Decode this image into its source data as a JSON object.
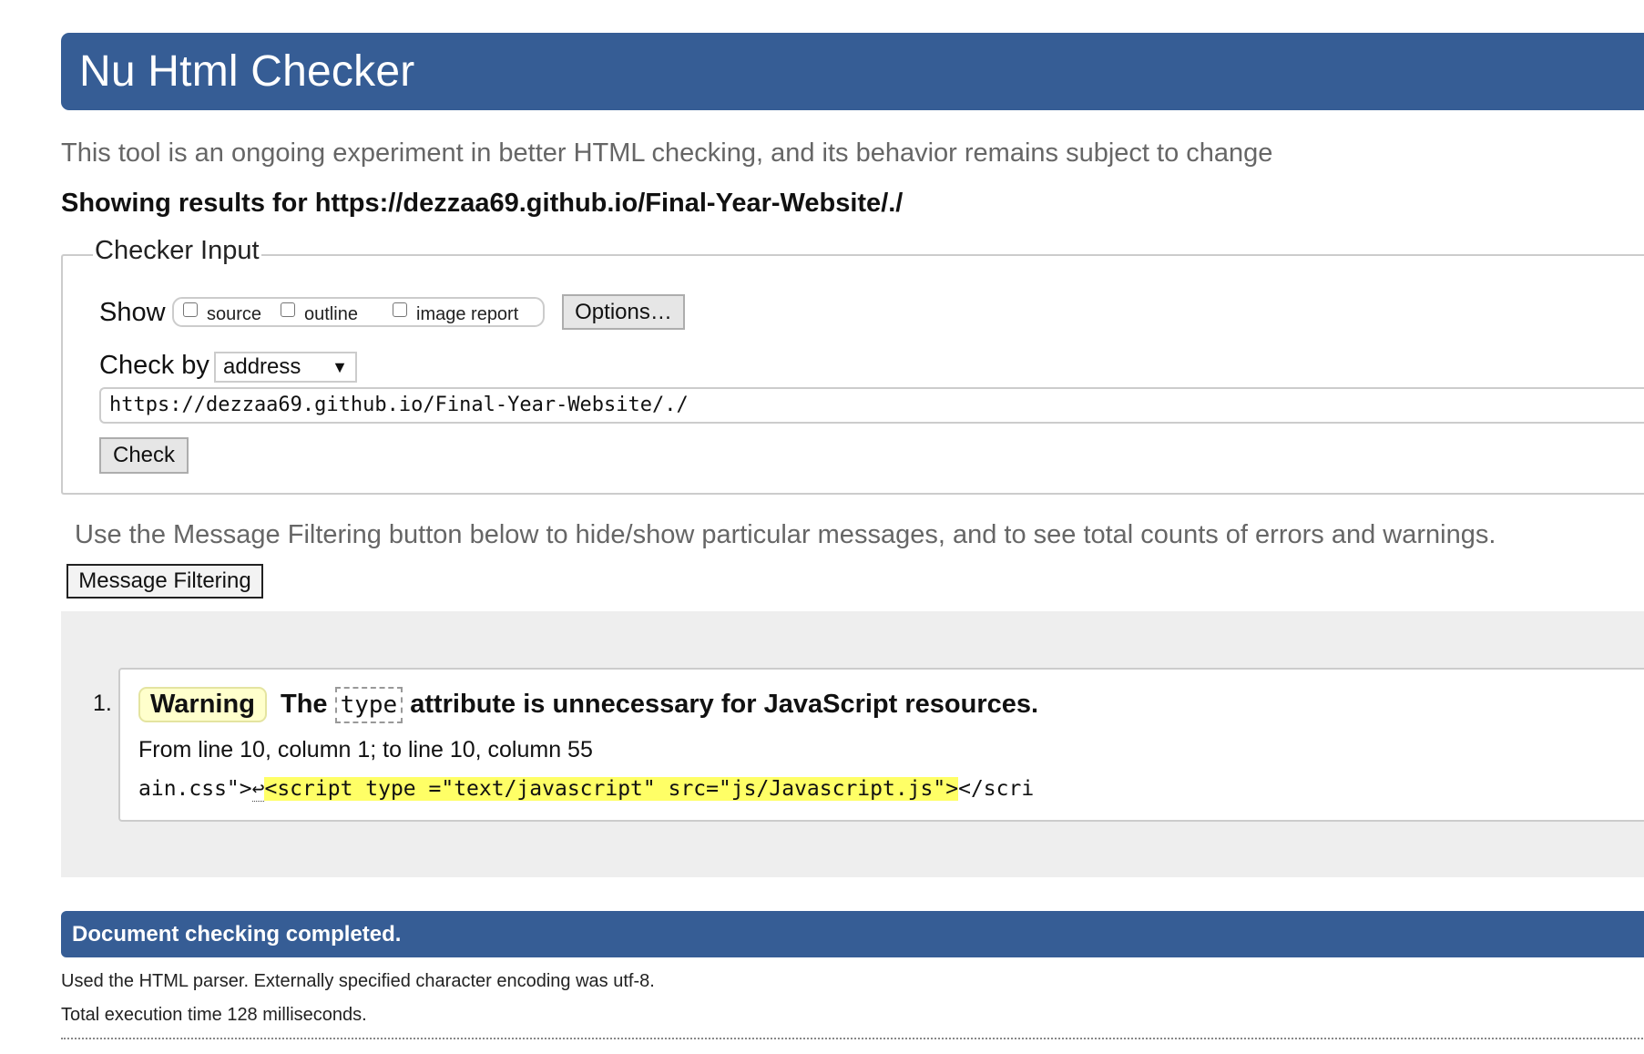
{
  "header": {
    "title": "Nu Html Checker"
  },
  "tagline": "This tool is an ongoing experiment in better HTML checking, and its behavior remains subject to change",
  "results_for": "Showing results for https://dezzaa69.github.io/Final-Year-Website/./",
  "checker_input": {
    "legend": "Checker Input",
    "show_label": "Show",
    "show_options": [
      {
        "label": "source",
        "checked": false
      },
      {
        "label": "outline",
        "checked": false
      },
      {
        "label": "image report",
        "checked": false
      }
    ],
    "options_button": "Options…",
    "check_by_label": "Check by",
    "check_by_selected": "address",
    "check_by_arrow": "▼",
    "url_value": "https://dezzaa69.github.io/Final-Year-Website/./",
    "check_button": "Check"
  },
  "filter": {
    "info": "Use the Message Filtering button below to hide/show particular messages, and to see total counts of errors and warnings.",
    "button_label": "Message Filtering"
  },
  "messages": [
    {
      "number": "1.",
      "severity": "Warning",
      "text_before": "The",
      "code": "type",
      "text_after": "attribute is unnecessary for JavaScript resources.",
      "location": "From line 10, column 1; to line 10, column 55",
      "extract_before": "ain.css\">",
      "extract_linefeed": "↩",
      "extract_highlight": "<script type =\"text/javascript\" src=\"js/Javascript.js\">",
      "extract_after": "</scri"
    }
  ],
  "completion": {
    "title": "Document checking completed.",
    "parser_info": "Used the HTML parser. Externally specified character encoding was utf-8.",
    "execution_time": "Total execution time 128 milliseconds."
  },
  "colors": {
    "banner": "#365d95",
    "warning_bg": "#ffffcc",
    "highlight": "#ffff66",
    "results_bg": "#eeeeee"
  }
}
